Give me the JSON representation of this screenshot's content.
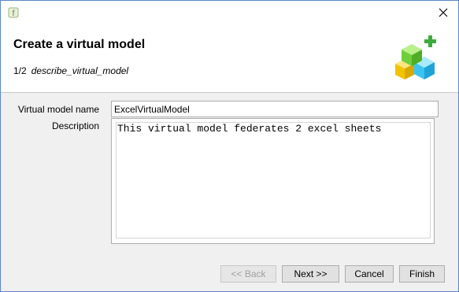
{
  "dialog": {
    "title": "Create a virtual model",
    "step_number": "1/2",
    "step_name": "describe_virtual_model"
  },
  "form": {
    "name_label": "Virtual model name",
    "name_value": "ExcelVirtualModel",
    "description_label": "Description",
    "description_value": "This virtual model federates 2 excel sheets"
  },
  "buttons": {
    "back": "<< Back",
    "next": "Next >>",
    "cancel": "Cancel",
    "finish": "Finish"
  },
  "icons": {
    "app": "app-icon",
    "close": "close-icon",
    "logo": "virtual-model-cubes-icon"
  },
  "colors": {
    "accent": "#5a87c9",
    "plus": "#3caa3c"
  }
}
